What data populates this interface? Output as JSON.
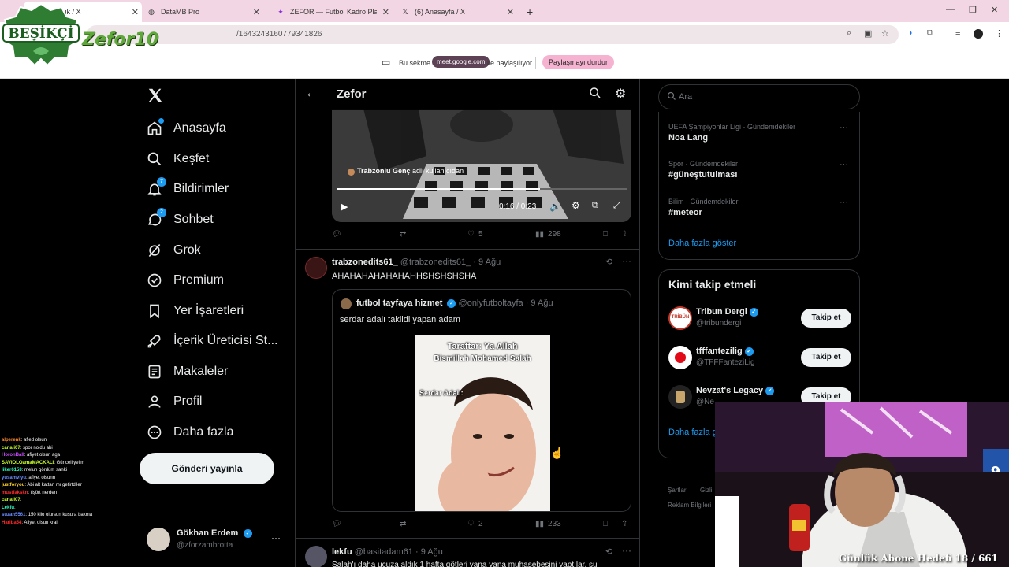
{
  "browser": {
    "tabs": [
      {
        "label": "Topluluk / X",
        "active": true
      },
      {
        "label": "DataMB Pro",
        "active": false
      },
      {
        "label": "ZEFOR — Futbol Kadro Planları",
        "active": false
      },
      {
        "label": "(6) Anasayfa / X",
        "active": false
      }
    ],
    "new_tab": "+",
    "url": "/1643243160779341826",
    "share": {
      "prefix": "Bu sekme",
      "domain": "meet.google.com",
      "suffix": "ile paylaşılıyor",
      "stop_label": "Paylaşmayı durdur"
    }
  },
  "overlay": {
    "logo_text": "BEŞİKÇİ",
    "logo_text2": "Zefor10",
    "goal_text": "Günlük Abone Hedefi 18 / 661"
  },
  "nav": {
    "items": [
      {
        "label": "Anasayfa",
        "icon": "home-icon"
      },
      {
        "label": "Keşfet",
        "icon": "search-icon"
      },
      {
        "label": "Bildirimler",
        "icon": "bell-icon",
        "badge": "7"
      },
      {
        "label": "Sohbet",
        "icon": "chat-icon",
        "badge": "2"
      },
      {
        "label": "Grok",
        "icon": "grok-icon"
      },
      {
        "label": "Premium",
        "icon": "premium-icon"
      },
      {
        "label": "Yer İşaretleri",
        "icon": "bookmark-icon"
      },
      {
        "label": "İçerik Üreticisi St...",
        "icon": "rocket-icon"
      },
      {
        "label": "Makaleler",
        "icon": "article-icon"
      },
      {
        "label": "Profil",
        "icon": "person-icon"
      },
      {
        "label": "Daha fazla",
        "icon": "more-circle-icon"
      }
    ],
    "post_button": "Gönderi yayınla",
    "profile": {
      "name": "Gökhan Erdem",
      "handle": "@zforzambrotta"
    }
  },
  "chat": [
    {
      "user": "alperenk",
      "msg": ": afied olsun",
      "color": "#ff8a2a"
    },
    {
      "user": "canali07",
      "msg": ": spor noldu abi",
      "color": "#c8ff2a"
    },
    {
      "user": "HoronBall",
      "msg": ": afiyet olsun aga",
      "color": "#c94dff"
    },
    {
      "user": "SAVIOLOamaMACKALI",
      "msg": ": Güncelliyelim",
      "color": "#c8ff2a"
    },
    {
      "user": "liker6153",
      "msg": ": melun gördüm sanki",
      "color": "#2affc0"
    },
    {
      "user": "yusamvlyu",
      "msg": ": afiyet olsunn",
      "color": "#6a8cff"
    },
    {
      "user": "justforyou",
      "msg": ": Abi alt kattan mı getirtdiler",
      "color": "#ffd42a"
    },
    {
      "user": "mustfakskn",
      "msg": ": tişört nerden",
      "color": "#ff2a2a"
    },
    {
      "user": "canali07",
      "msg": ":",
      "color": "#c8ff2a"
    },
    {
      "user": "Lekfu",
      "msg": ":",
      "color": "#2affc0"
    },
    {
      "user": "suzan5561",
      "msg": ": 150 kilo olursun kusura bakma",
      "color": "#6a8cff"
    },
    {
      "user": "Hariba54",
      "msg": ": Afiyet olsun kral",
      "color": "#ff2a2a"
    }
  ],
  "main": {
    "title": "Zefor",
    "video_post": {
      "overlay_text": "Trabzonlu Genç",
      "overlay_suffix": "adlı kullanıcıdan",
      "time": "0:16 / 0:23",
      "progress": 0.7,
      "likes": "5",
      "views": "298"
    },
    "post2": {
      "name": "trabzonedits61_",
      "handle": "@trabzonedits61_",
      "date": "· 9 Ağu",
      "text": "AHAHAHAHAHAHAHHSHSHSHSHA",
      "quote": {
        "name": "futbol tayfaya hizmet",
        "handle": "@onlyfutboltayfa",
        "date": "· 9 Ağu",
        "text": "serdar adalı taklidi yapan adam",
        "caption1": "Taraftar: Ya Allah",
        "caption2": "Bismillah Mohamed Salah",
        "caption3": "Serdar Adalı:"
      },
      "likes": "2",
      "views": "233"
    },
    "post3": {
      "name": "lekfu",
      "handle": "@basitadam61",
      "date": "· 9 Ağu",
      "text": "Salah'ı daha ucuza aldık 1 hafta götleri yana yana muhasebesini yaptılar, şu"
    }
  },
  "right": {
    "search_placeholder": "Ara",
    "trends": [
      {
        "category": "UEFA Şampiyonlar Ligi · Gündemdekiler",
        "name": "Noa Lang"
      },
      {
        "category": "Spor · Gündemdekiler",
        "name": "#güneştutulması"
      },
      {
        "category": "Bilim · Gündemdekiler",
        "name": "#meteor"
      }
    ],
    "show_more": "Daha fazla göster",
    "who_title": "Kimi takip etmeli",
    "follow": [
      {
        "name": "Tribun Dergi",
        "handle": "@tribundergi",
        "btn": "Takip et"
      },
      {
        "name": "tfffantezilig",
        "handle": "@TFFFanteziLig",
        "btn": "Takip et"
      },
      {
        "name": "Nevzat's Legacy",
        "handle": "@Ne",
        "btn": "Takip et"
      }
    ],
    "who_more": "Daha fazla g",
    "footer1": "Şartlar",
    "footer1b": "Gizli",
    "footer2": "Reklam Bilgileri"
  }
}
